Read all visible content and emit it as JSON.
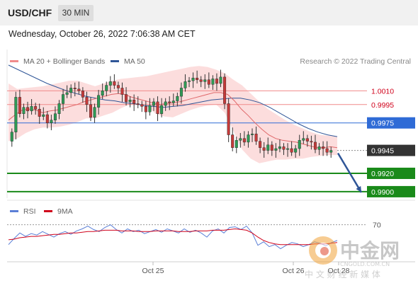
{
  "header": {
    "symbol": "USD/CHF",
    "timeframe": "30 MIN"
  },
  "datetime": "Wednesday, October 26, 2022 7:06:38 AM CET",
  "legend": {
    "ma20": "MA 20 + Bollinger Bands",
    "ma50": "MA 50",
    "credit": "Research © 2022 Trading Central",
    "ma20_color": "#f08a8a",
    "ma50_color": "#2f5597"
  },
  "rsi_legend": {
    "rsi": "RSI",
    "ma": "9MA",
    "rsi_color": "#5b7fd6",
    "ma_color": "#d0021b"
  },
  "watermark": {
    "brand": "中金网",
    "domain": "CNGOLD.COM.CN",
    "tagline": "中 文 财 经 新 媒 体"
  },
  "chart_data": [
    {
      "type": "candlestick",
      "title": "USD/CHF",
      "x_tick_labels": [
        "Oct 25",
        "Oct 26",
        "Oct 28"
      ],
      "ylim": [
        0.9893,
        1.0055
      ],
      "levels": [
        {
          "value": 1.001,
          "label": "1.0010",
          "kind": "resistance",
          "color": "#d0021b"
        },
        {
          "value": 0.9995,
          "label": "0.9995",
          "kind": "resistance",
          "color": "#d0021b"
        },
        {
          "value": 0.9975,
          "label": "0.9975",
          "kind": "pivot",
          "color": "#2f6bd6"
        },
        {
          "value": 0.9945,
          "label": "0.9945",
          "kind": "last price",
          "color": "#333333"
        },
        {
          "value": 0.992,
          "label": "0.9920",
          "kind": "support",
          "color": "#1a8a1a"
        },
        {
          "value": 0.99,
          "label": "0.9900",
          "kind": "support",
          "color": "#1a8a1a"
        }
      ],
      "forecast_arrow": {
        "from": 0.9942,
        "to": 0.99,
        "color": "#2f5597"
      },
      "price_path": [
        0.9955,
        0.9965,
        1.0003,
        0.9985,
        0.9992,
        0.9988,
        0.9993,
        0.999,
        0.9982,
        0.9984,
        0.9975,
        0.9978,
        0.9985,
        0.9996,
        1.0006,
        1.0008,
        1.0013,
        1.0012,
        1.001,
        1.0003,
        0.9995,
        0.9981,
        0.9992,
        1.0005,
        1.001,
        1.0016,
        1.002,
        1.0016,
        1.0013,
        1.0006,
        0.9998,
        1.0,
        0.9996,
        0.9995,
        0.9993,
        0.9987,
        0.9994,
        0.9998,
        0.9985,
        0.9994,
        0.9998,
        0.9997,
        0.9999,
        1.0004,
        1.0013,
        1.002,
        1.0021,
        1.0024,
        1.0022,
        1.002,
        1.0022,
        1.0017,
        1.0023,
        1.0018,
        1.0025,
        0.9996,
        0.9962,
        0.9948,
        0.9956,
        0.9958,
        0.9954,
        0.9962,
        0.9963,
        0.9955,
        0.9948,
        0.9945,
        0.9951,
        0.9945,
        0.9947,
        0.9949,
        0.9946,
        0.9947,
        0.9943,
        0.9947,
        0.9956,
        0.9958,
        0.9955,
        0.9954,
        0.9946,
        0.9949,
        0.9947,
        0.9943,
        0.9945
      ],
      "ma20_path": [
        0.9978,
        0.9984,
        0.9989,
        0.999,
        0.9989,
        0.9986,
        0.9988,
        0.9989,
        0.9991,
        0.9993,
        0.9995,
        0.9998,
        1.0,
        1.0002,
        1.0004,
        1.0006,
        1.0007,
        1.0006,
        1.0003,
        1.0001,
        0.9999,
        0.9997,
        0.9995,
        0.9996,
        0.9997,
        0.9998,
        1.0,
        1.0002,
        1.0004,
        1.0006,
        1.0008,
        1.0008,
        1.0006,
        0.9999,
        0.999,
        0.9983,
        0.9975,
        0.9968,
        0.9962,
        0.9958,
        0.9956,
        0.9955,
        0.9954,
        0.9952,
        0.995,
        0.9948,
        0.9948,
        0.9949,
        0.9948
      ],
      "bb_upper_path": [
        1.0018,
        1.0012,
        1.0013,
        1.0014,
        1.0015,
        1.0017,
        1.0019,
        1.0021,
        1.0021,
        1.0018,
        1.0015,
        1.0018,
        1.0021,
        1.0023,
        1.0024,
        1.0025,
        1.0026,
        1.0028,
        1.003,
        1.0032,
        1.0034,
        1.0036,
        1.0037,
        1.0036,
        1.0033,
        1.0029,
        1.0022,
        1.0016,
        1.0007,
        0.9998,
        0.999,
        0.9984,
        0.9978,
        0.9973,
        0.9969,
        0.9965,
        0.9962,
        0.9961,
        0.996
      ],
      "bb_lower_path": [
        0.9955,
        0.9958,
        0.9964,
        0.9968,
        0.997,
        0.997,
        0.9971,
        0.9973,
        0.9976,
        0.998,
        0.998,
        0.9983,
        0.9986,
        0.9991,
        0.9995,
        0.9997,
        0.9993,
        0.9985,
        0.9982,
        0.9981,
        0.9985,
        0.9989,
        0.9992,
        0.9994,
        0.9995,
        0.9986,
        0.9966,
        0.9946,
        0.9936,
        0.9931,
        0.9933,
        0.9935,
        0.9935,
        0.9936,
        0.9936,
        0.9938,
        0.9939,
        0.994,
        0.994
      ],
      "ma50_path": [
        1.0038,
        1.0033,
        1.0028,
        1.0023,
        1.0018,
        1.0014,
        1.001,
        1.0007,
        1.0004,
        1.0002,
        1.0,
        0.9999,
        0.9997,
        0.9996,
        0.9994,
        0.9993,
        0.9992,
        0.9993,
        0.9994,
        0.9996,
        0.9998,
        1.0,
        1.0001,
        1.0002,
        1.0002,
        1.0,
        0.9997,
        0.9992,
        0.9986,
        0.998,
        0.9974,
        0.9969,
        0.9965,
        0.9962,
        0.996
      ]
    },
    {
      "type": "line",
      "title": "RSI",
      "ylim": [
        20,
        80
      ],
      "y_tick_labels": [
        "70"
      ],
      "reference_level": 70,
      "series": [
        {
          "name": "RSI",
          "values": [
            41,
            50,
            58,
            53,
            57,
            55,
            60,
            56,
            52,
            57,
            60,
            56,
            61,
            64,
            68,
            63,
            60,
            66,
            70,
            63,
            58,
            64,
            60,
            62,
            57,
            60,
            63,
            59,
            64,
            61,
            58,
            64,
            59,
            62,
            58,
            52,
            61,
            64,
            58,
            66,
            67,
            63,
            68,
            58,
            40,
            45,
            38,
            41,
            35,
            40,
            44,
            42,
            38,
            41,
            45,
            43,
            39,
            44,
            47
          ]
        },
        {
          "name": "9MA",
          "values": [
            48,
            49,
            51,
            52,
            53,
            53,
            54,
            55,
            56,
            56,
            57,
            58,
            58,
            59,
            60,
            60,
            61,
            62,
            62,
            62,
            61,
            61,
            61,
            60,
            60,
            60,
            61,
            61,
            61,
            61,
            60,
            60,
            60,
            61,
            61,
            61,
            62,
            62,
            62,
            63,
            64,
            63,
            62,
            58,
            52,
            47,
            44,
            42,
            41,
            41,
            41,
            41,
            41,
            41,
            42,
            42,
            42,
            43,
            44
          ]
        }
      ]
    }
  ]
}
